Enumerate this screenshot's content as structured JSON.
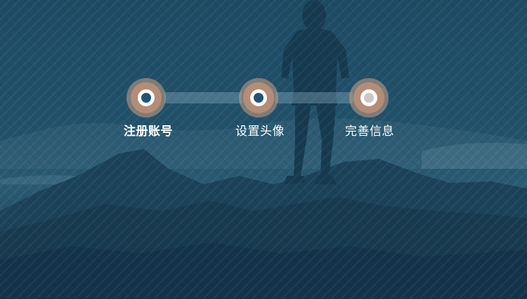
{
  "wizard": {
    "steps": [
      {
        "label": "注册账号",
        "state": "active"
      },
      {
        "label": "设置头像",
        "state": "active"
      },
      {
        "label": "完善信息",
        "state": "inactive"
      }
    ]
  },
  "colors": {
    "background": "#1c4a63",
    "ring": "#b48d78",
    "active_core": "#1f557c",
    "inactive_core": "#c8c8c8",
    "label": "#ffffff"
  }
}
